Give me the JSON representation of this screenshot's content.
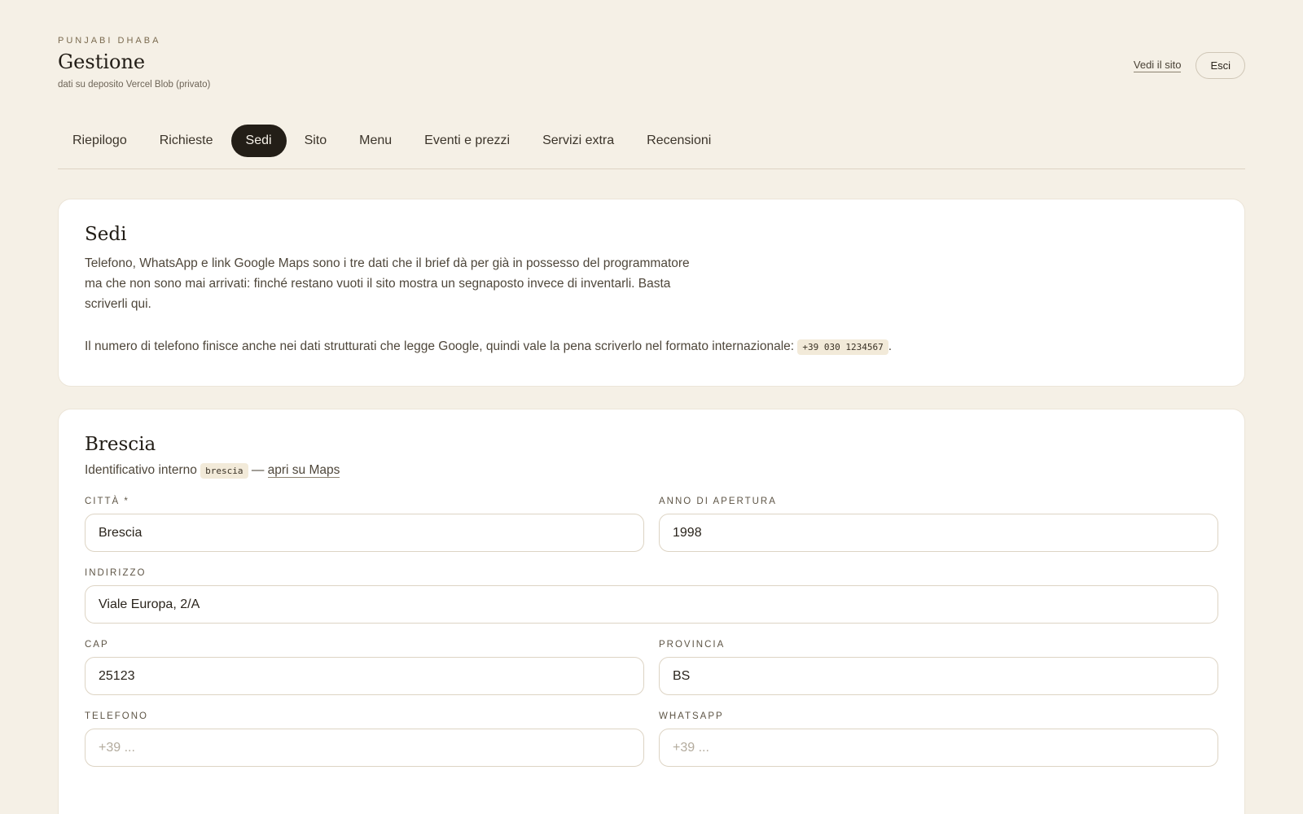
{
  "header": {
    "kicker": "PUNJABI DHABA",
    "title": "Gestione",
    "subtitle": "dati su deposito Vercel Blob (privato)",
    "view_site": "Vedi il sito",
    "logout": "Esci"
  },
  "tabs": [
    {
      "label": "Riepilogo",
      "active": false
    },
    {
      "label": "Richieste",
      "active": false
    },
    {
      "label": "Sedi",
      "active": true
    },
    {
      "label": "Sito",
      "active": false
    },
    {
      "label": "Menu",
      "active": false
    },
    {
      "label": "Eventi e prezzi",
      "active": false
    },
    {
      "label": "Servizi extra",
      "active": false
    },
    {
      "label": "Recensioni",
      "active": false
    }
  ],
  "intro": {
    "title": "Sedi",
    "paragraph1": "Telefono, WhatsApp e link Google Maps sono i tre dati che il brief dà per già in possesso del programmatore ma che non sono mai arrivati: finché restano vuoti il sito mostra un segnaposto invece di inventarli. Basta scriverli qui.",
    "paragraph2_prefix": "Il numero di telefono finisce anche nei dati strutturati che legge Google, quindi vale la pena scriverlo nel formato internazionale:",
    "phone_format": "+39 030 1234567",
    "paragraph2_suffix": "."
  },
  "location": {
    "title": "Brescia",
    "id_label": "Identificativo interno",
    "id_value": "brescia",
    "separator": "—",
    "maps_link": "apri su Maps",
    "fields": {
      "city": {
        "label": "CITTÀ *",
        "value": "Brescia",
        "placeholder": ""
      },
      "year": {
        "label": "ANNO DI APERTURA",
        "value": "1998",
        "placeholder": ""
      },
      "address": {
        "label": "INDIRIZZO",
        "value": "Viale Europa, 2/A",
        "placeholder": ""
      },
      "cap": {
        "label": "CAP",
        "value": "25123",
        "placeholder": ""
      },
      "province": {
        "label": "PROVINCIA",
        "value": "BS",
        "placeholder": ""
      },
      "phone": {
        "label": "TELEFONO",
        "value": "",
        "placeholder": "+39 ..."
      },
      "whatsapp": {
        "label": "WHATSAPP",
        "value": "",
        "placeholder": "+39 ..."
      }
    }
  },
  "colors": {
    "background": "#f5f0e6",
    "active_tab": "#231e17",
    "card": "#ffffff"
  }
}
